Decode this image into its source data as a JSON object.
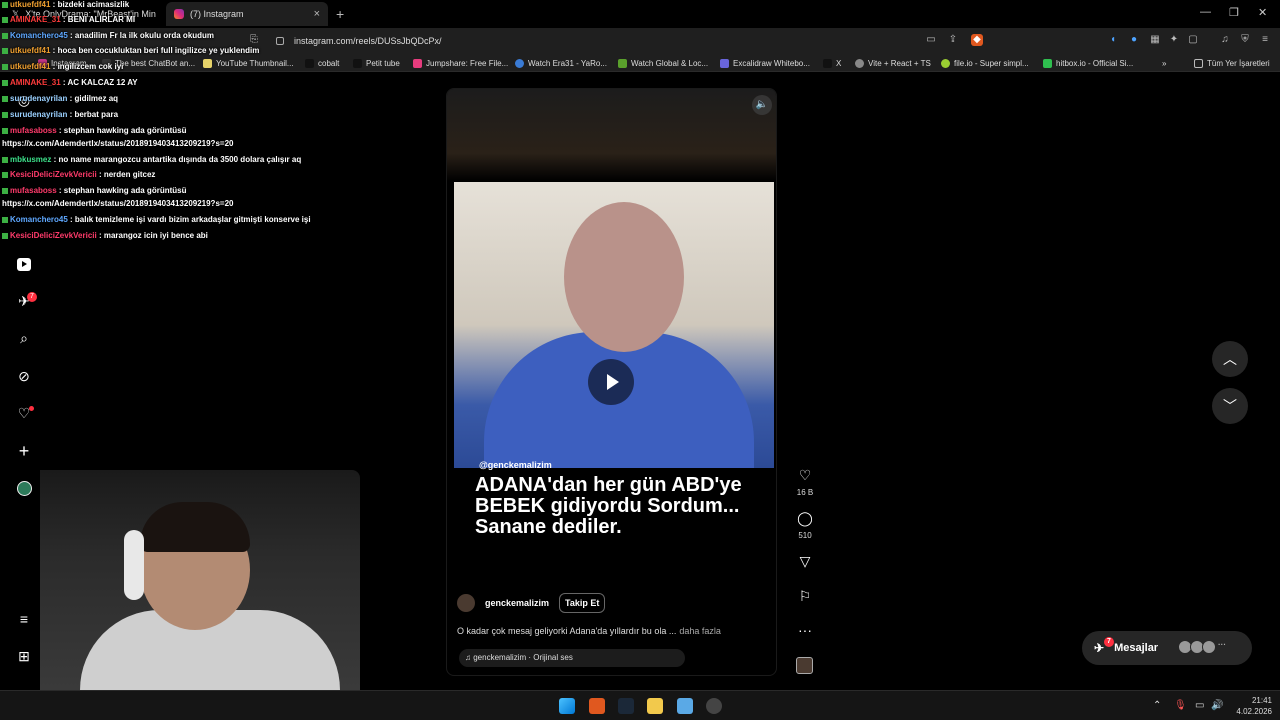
{
  "browser": {
    "tab_inactive_label": "X'te OnlyDrama: \"MrBeast'in Minecra",
    "tab_active_label": "(7) Instagram",
    "url": "instagram.com/reels/DUSsJbQDcPx/",
    "bookmarks": [
      "Instagram",
      "The best ChatBot an...",
      "YouTube Thumbnail...",
      "cobalt",
      "Petit tube",
      "Jumpshare: Free File...",
      "Watch Era31 - YaRo...",
      "Watch Global & Loc...",
      "Excalidraw Whitebo...",
      "X",
      "Vite + React + TS",
      "file.io - Super simpl...",
      "hitbox.io - Official Si..."
    ],
    "bookmarks_more": "»",
    "all_bookmarks": "Tüm Yer İşaretleri"
  },
  "chat": [
    {
      "user": "utkuefdf41",
      "text": " : bizdeki acimasizlik",
      "color": "#f0a030"
    },
    {
      "user": "AMINAKE_31",
      "text": " : BENI ALIRLAR MI",
      "color": "#ff3b3b"
    },
    {
      "user": "Komanchero45",
      "text": " : anadilim Fr la ilk okulu orda okudum",
      "color": "#5fa8ff"
    },
    {
      "user": "utkuefdf41",
      "text": " : hoca ben cocukluktan beri full ingilizce ye yuklendim",
      "color": "#f0a030"
    },
    {
      "user": "utkuefdf41",
      "text": " : ingilizcem cok iyi",
      "color": "#f0a030"
    },
    {
      "user": "AMINAKE_31",
      "text": " : AC KALCAZ 12 AY",
      "color": "#ff3b3b"
    },
    {
      "user": "surudenayrilan",
      "text": " : gidilmez aq",
      "color": "#9ad0ff"
    },
    {
      "user": "surudenayrilan",
      "text": " : berbat para",
      "color": "#9ad0ff"
    },
    {
      "user": "mufasaboss",
      "text": " : stephan hawking ada görüntüsü",
      "color": "#ff3b6b"
    },
    {
      "user": "",
      "text": "https://x.com/Ademdertlx/status/2018919403413209219?s=20",
      "color": "#fff"
    },
    {
      "user": "mbkusmez",
      "text": " : no name marangozcu antartika dışında da 3500 dolara çalışır aq",
      "color": "#3ce08a"
    },
    {
      "user": "KesiciDeliciZevkVericii",
      "text": " : nerden gitcez",
      "color": "#ff3b6b"
    },
    {
      "user": "mufasaboss",
      "text": " : stephan hawking ada görüntüsü",
      "color": "#ff3b6b"
    },
    {
      "user": "",
      "text": "https://x.com/Ademdertlx/status/2018919403413209219?s=20",
      "color": "#fff"
    },
    {
      "user": "Komanchero45",
      "text": " : balık temizleme işi vardı bizim arkadaşlar gitmişti konserve işi",
      "color": "#5fa8ff"
    },
    {
      "user": "KesiciDeliciZevkVericii",
      "text": " : marangoz icin iyi bence abi",
      "color": "#ff3b6b"
    }
  ],
  "sidebar": {
    "icons": [
      "instagram-icon",
      "search-icon",
      "reels-icon",
      "messages-icon",
      "search-icon",
      "explore-icon",
      "notifications-icon",
      "create-icon",
      "profile-icon",
      "menu-icon",
      "more-icon"
    ],
    "notif_count": "7"
  },
  "reel": {
    "handle_overlay": "@genckemalizim",
    "caption_overlay": "ADANA'dan her gün ABD'ye BEBEK gidiyordu Sordum... Sanane dediler.",
    "author": "genckemalizim",
    "follow_label": "Takip Et",
    "description": "O kadar çok mesaj geliyorki Adana'da yıllardır bu ola ...",
    "more_label": "daha fazla",
    "audio": "genckemalizim · Orijinal ses",
    "likes": "16 B",
    "comments": "510"
  },
  "messages": {
    "label": "Mesajlar",
    "badge": "7",
    "more": "···"
  },
  "taskbar": {
    "time": "21:41",
    "date": "4.02.2026"
  },
  "colors": {
    "accent": "#ff3040",
    "bg": "#000000",
    "chrome": "#1f1f1f"
  }
}
